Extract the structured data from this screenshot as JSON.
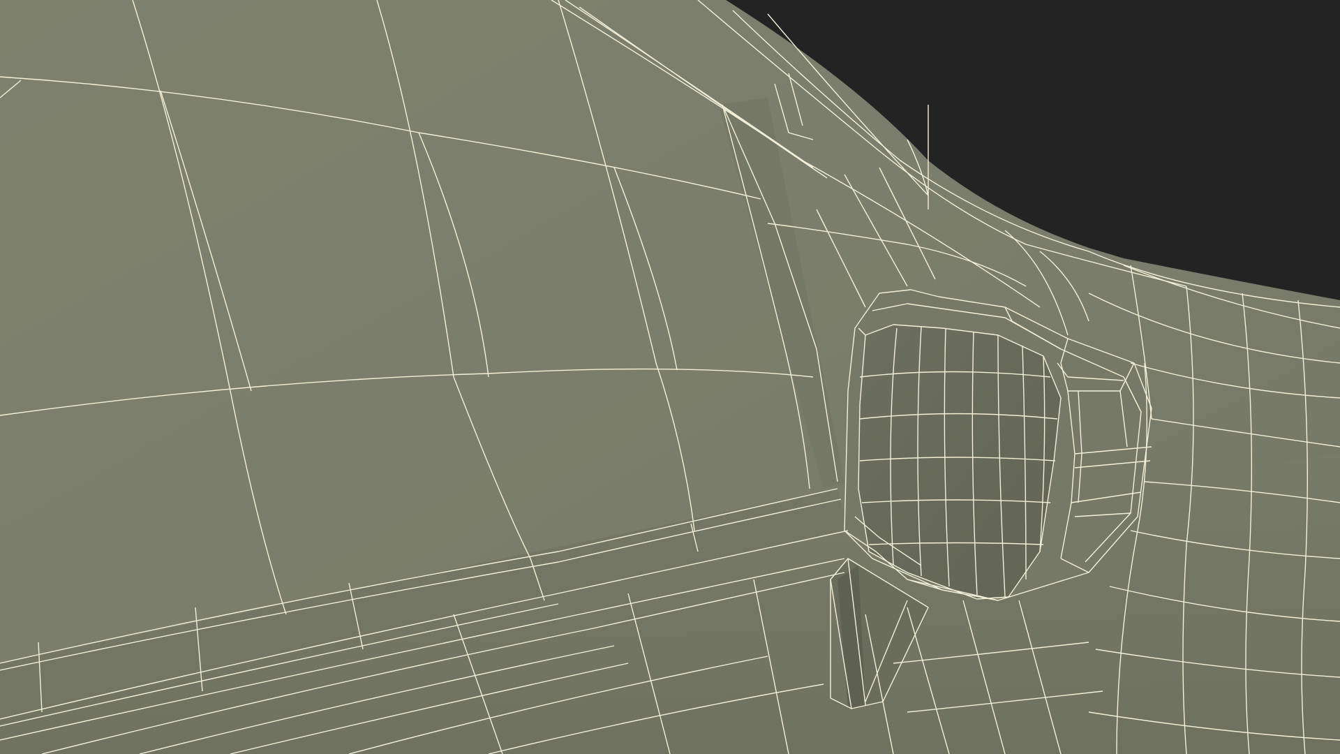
{
  "scene": {
    "subject": "wireframe-car-side-mirror",
    "colors": {
      "background": "#232323",
      "body": "#7d7f6e",
      "body_dark": "#707262",
      "body_shadow": "#5f6153",
      "mirror_face": "#6f7162",
      "mirror_inner": "#666858",
      "wire": "#f4f0d8"
    }
  }
}
